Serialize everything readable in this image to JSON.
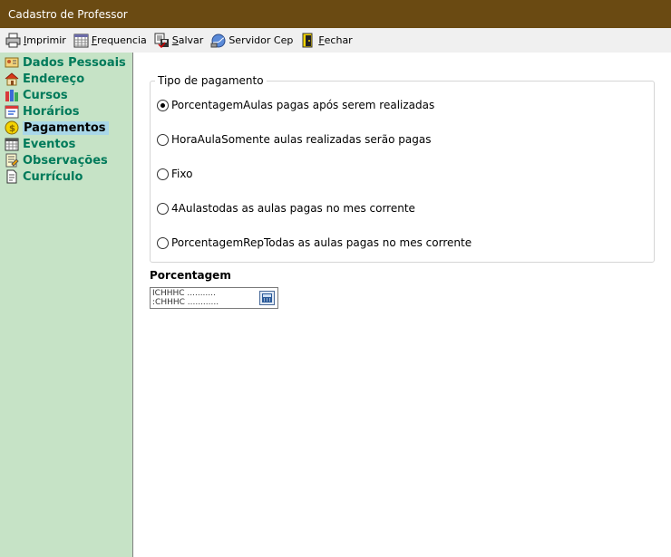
{
  "window": {
    "title": "Cadastro de Professor"
  },
  "toolbar": {
    "items": [
      {
        "prefix": "",
        "hotkey": "I",
        "rest": "mprimir",
        "icon": "printer-icon"
      },
      {
        "prefix": "",
        "hotkey": "F",
        "rest": "requencia",
        "icon": "calendar-grid-icon"
      },
      {
        "prefix": "",
        "hotkey": "S",
        "rest": "alvar",
        "icon": "save-icon"
      },
      {
        "prefix": "",
        "hotkey": "",
        "rest": "Servidor Cep",
        "icon": "globe-icon"
      },
      {
        "prefix": "",
        "hotkey": "F",
        "rest": "echar",
        "icon": "exit-door-icon"
      }
    ]
  },
  "sidebar": {
    "items": [
      {
        "label": "Dados Pessoais",
        "icon": "id-card-icon",
        "active": false
      },
      {
        "label": "Endereço",
        "icon": "house-icon",
        "active": false
      },
      {
        "label": "Cursos",
        "icon": "books-icon",
        "active": false
      },
      {
        "label": "Horários",
        "icon": "schedule-icon",
        "active": false
      },
      {
        "label": "Pagamentos",
        "icon": "coin-icon",
        "active": true
      },
      {
        "label": "Eventos",
        "icon": "calendar-icon",
        "active": false
      },
      {
        "label": "Observações",
        "icon": "note-icon",
        "active": false
      },
      {
        "label": "Currículo",
        "icon": "document-icon",
        "active": false
      }
    ]
  },
  "payment": {
    "group_label": "Tipo de pagamento",
    "options": [
      {
        "label": "PorcentagemAulas pagas após serem realizadas",
        "checked": true
      },
      {
        "label": "HoraAulaSomente aulas realizadas serão pagas",
        "checked": false
      },
      {
        "label": "Fixo",
        "checked": false
      },
      {
        "label": "4Aulastodas as aulas pagas no mes corrente",
        "checked": false
      },
      {
        "label": "PorcentagemRepTodas as aulas pagas no mes corrente",
        "checked": false
      }
    ]
  },
  "percentage": {
    "label": "Porcentagem",
    "value": "ICHHHC ...........\n:CHHHC ............"
  },
  "colors": {
    "titlebar": "#6a4a12",
    "sidebar": "#c6e3c6",
    "sidebar_text": "#007a5a",
    "active_highlight": "#a9d7e8"
  }
}
